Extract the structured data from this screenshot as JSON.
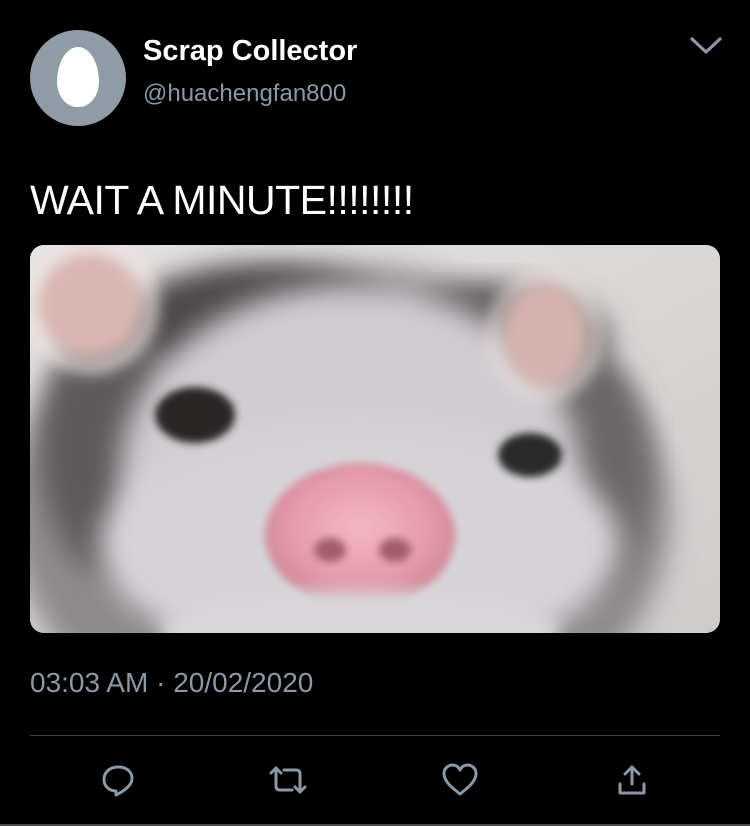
{
  "tweet": {
    "display_name": "Scrap Collector",
    "handle": "@huachengfan800",
    "text": "WAIT A MINUTE!!!!!!!!",
    "time": "03:03 AM",
    "separator": "·",
    "date": "20/02/2020"
  },
  "icons": {
    "menu": "chevron-down-icon",
    "avatar": "default-egg-avatar",
    "reply": "reply-icon",
    "retweet": "retweet-icon",
    "like": "heart-icon",
    "share": "share-icon"
  },
  "colors": {
    "background": "#000000",
    "primary_text": "#ffffff",
    "secondary_text": "#8b98a5",
    "divider": "#38444d",
    "icon": "#8b98a5",
    "avatar_bg": "#8f9ba5"
  }
}
